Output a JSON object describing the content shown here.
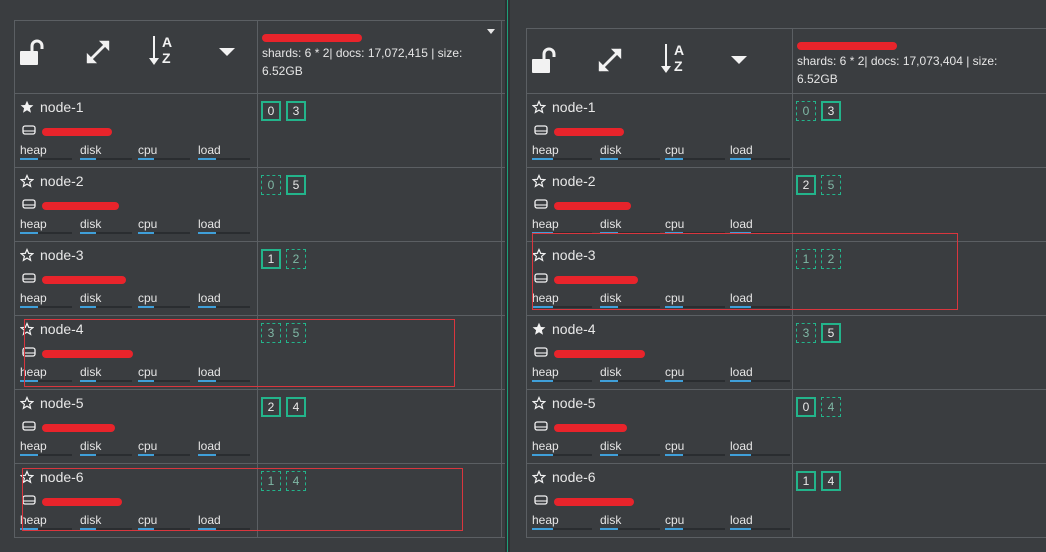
{
  "toolbar": {
    "icons": [
      "unlock-icon",
      "expand-icon",
      "sort-az-icon",
      "dropdown-icon"
    ],
    "sort_label_top": "A",
    "sort_label_bottom": "Z"
  },
  "left": {
    "index_stats": "shards: 6 * 2| docs: 17,072,415 | size: 6.52GB",
    "nodes": [
      {
        "name": "node-1",
        "master": true,
        "shards": [
          {
            "id": "0",
            "type": "primary"
          },
          {
            "id": "3",
            "type": "primary"
          }
        ]
      },
      {
        "name": "node-2",
        "master": false,
        "shards": [
          {
            "id": "0",
            "type": "replica"
          },
          {
            "id": "5",
            "type": "primary"
          }
        ]
      },
      {
        "name": "node-3",
        "master": false,
        "shards": [
          {
            "id": "1",
            "type": "primary"
          },
          {
            "id": "2",
            "type": "replica"
          }
        ]
      },
      {
        "name": "node-4",
        "master": false,
        "shards": [
          {
            "id": "3",
            "type": "replica"
          },
          {
            "id": "5",
            "type": "replica"
          }
        ]
      },
      {
        "name": "node-5",
        "master": false,
        "shards": [
          {
            "id": "2",
            "type": "primary"
          },
          {
            "id": "4",
            "type": "primary"
          }
        ]
      },
      {
        "name": "node-6",
        "master": false,
        "shards": [
          {
            "id": "1",
            "type": "replica"
          },
          {
            "id": "4",
            "type": "replica"
          }
        ]
      }
    ]
  },
  "right": {
    "index_stats": "shards: 6 * 2| docs: 17,073,404 | size: 6.52GB",
    "nodes": [
      {
        "name": "node-1",
        "master": false,
        "shards": [
          {
            "id": "0",
            "type": "replica"
          },
          {
            "id": "3",
            "type": "primary"
          }
        ]
      },
      {
        "name": "node-2",
        "master": false,
        "shards": [
          {
            "id": "2",
            "type": "primary"
          },
          {
            "id": "5",
            "type": "replica"
          }
        ]
      },
      {
        "name": "node-3",
        "master": false,
        "shards": [
          {
            "id": "1",
            "type": "replica"
          },
          {
            "id": "2",
            "type": "replica"
          }
        ]
      },
      {
        "name": "node-4",
        "master": true,
        "shards": [
          {
            "id": "3",
            "type": "replica"
          },
          {
            "id": "5",
            "type": "primary"
          }
        ]
      },
      {
        "name": "node-5",
        "master": false,
        "shards": [
          {
            "id": "0",
            "type": "primary"
          },
          {
            "id": "4",
            "type": "replica"
          }
        ]
      },
      {
        "name": "node-6",
        "master": false,
        "shards": [
          {
            "id": "1",
            "type": "primary"
          },
          {
            "id": "4",
            "type": "primary"
          }
        ]
      }
    ]
  },
  "metric_labels": [
    "heap",
    "disk",
    "cpu",
    "load"
  ],
  "metric_levels": [
    0.35,
    0.3,
    0.3,
    0.35
  ],
  "colors": {
    "background": "#3a3d40",
    "grid": "#5b5f63",
    "shard_border": "#23b48b",
    "metric_fill": "#3f9fd9",
    "highlight": "#d9363e",
    "redaction": "#e8242b"
  }
}
